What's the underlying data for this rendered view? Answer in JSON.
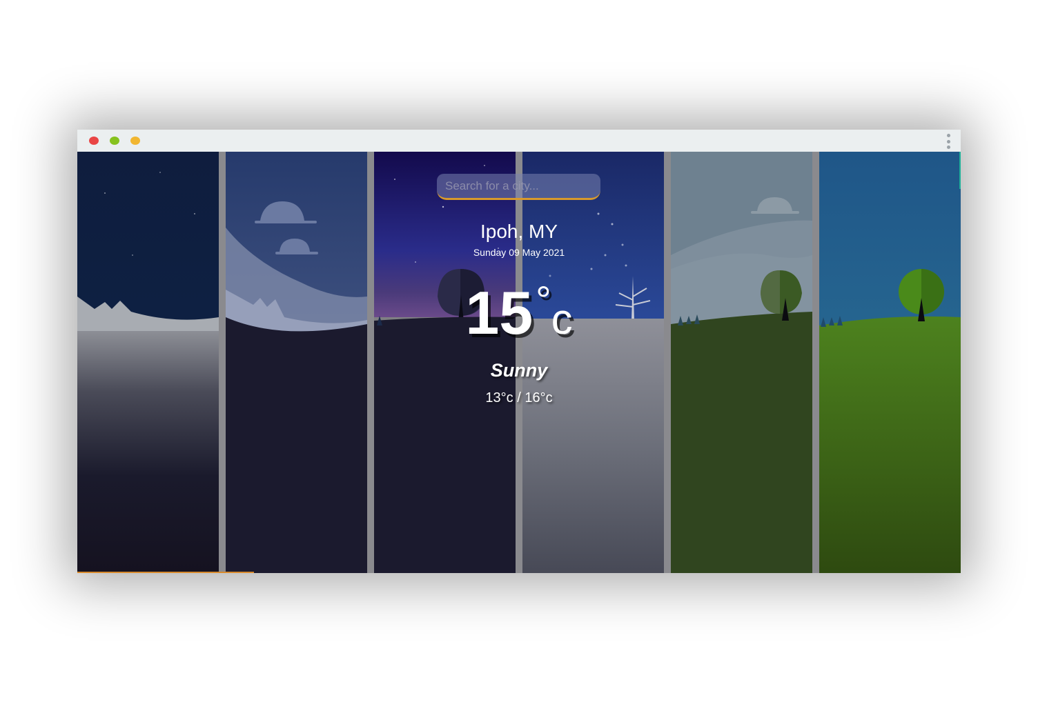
{
  "window": {
    "controls": [
      {
        "name": "close-dot",
        "color": "#e94545"
      },
      {
        "name": "minimize-dot",
        "color": "#86c21e"
      },
      {
        "name": "maximize-dot",
        "color": "#f1b631"
      }
    ],
    "menu_icon": "vertical-dots-icon"
  },
  "search": {
    "placeholder": "Search for a city..."
  },
  "weather": {
    "city": "Ipoh, MY",
    "date": "Sunday 09 May 2021",
    "temperature": "15",
    "degree_symbol": "°",
    "unit": "c",
    "condition": "Sunny",
    "range": "13°c / 16°c"
  },
  "colors": {
    "search_underline": "#d89a2c",
    "bottom_accent": "#d88a2d",
    "right_accent": "#20b09a"
  }
}
